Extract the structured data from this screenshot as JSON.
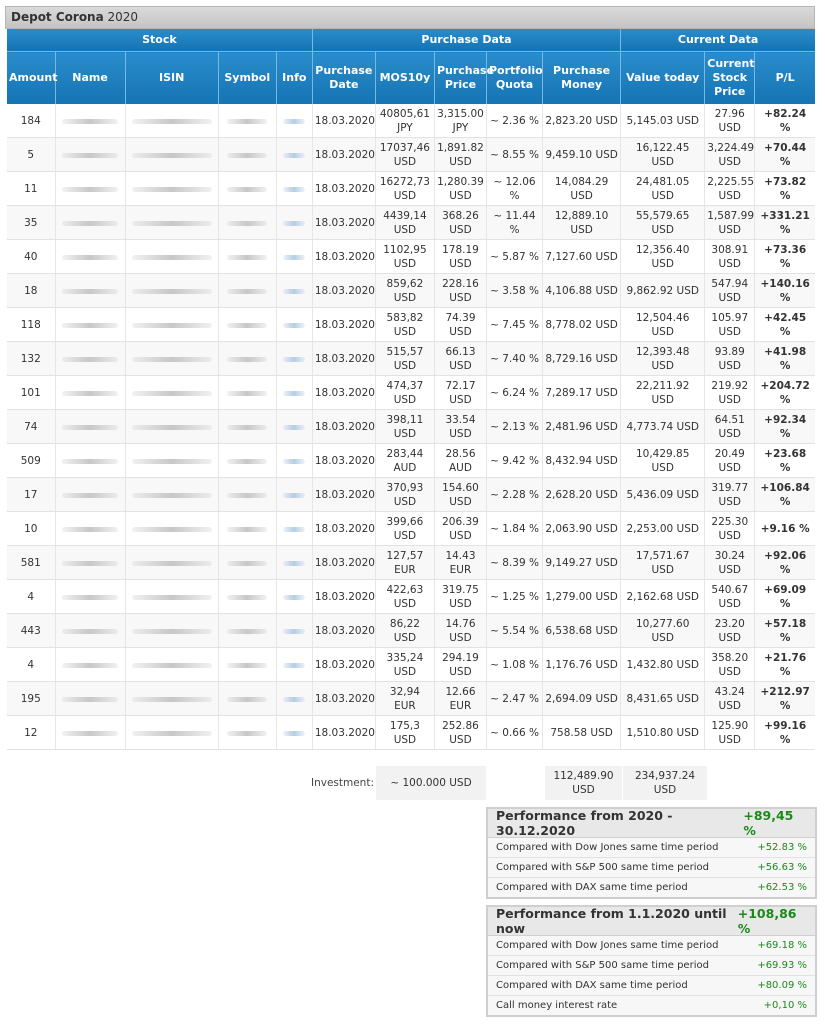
{
  "title": {
    "name": "Depot Corona",
    "year": "2020"
  },
  "groups": {
    "stock": "Stock",
    "purchase": "Purchase Data",
    "current": "Current Data"
  },
  "columns": {
    "amount": "Amount",
    "name": "Name",
    "isin": "ISIN",
    "symbol": "Symbol",
    "info": "Info",
    "purchase_date": "Purchase Date",
    "mos": "MOS10y",
    "purchase_price": "Purchase Price",
    "quota": "Portfolio Quota",
    "purchase_money": "Purchase Money",
    "value_today": "Value today",
    "current_price": "Current Stock Price",
    "pl": "P/L"
  },
  "rows": [
    {
      "amount": "184",
      "date": "18.03.2020",
      "mos": "40805,61",
      "mos_cur": "JPY",
      "price": "3,315.00",
      "price_cur": "JPY",
      "quota": "~ 2.36 %",
      "money": "2,823.20 USD",
      "value": "5,145.03 USD",
      "cur_price": "27.96",
      "cur_price_cur": "USD",
      "pl": "+82.24 %"
    },
    {
      "amount": "5",
      "date": "18.03.2020",
      "mos": "17037,46",
      "mos_cur": "USD",
      "price": "1,891.82",
      "price_cur": "USD",
      "quota": "~ 8.55 %",
      "money": "9,459.10 USD",
      "value": "16,122.45 USD",
      "cur_price": "3,224.49",
      "cur_price_cur": "USD",
      "pl": "+70.44 %"
    },
    {
      "amount": "11",
      "date": "18.03.2020",
      "mos": "16272,73",
      "mos_cur": "USD",
      "price": "1,280.39",
      "price_cur": "USD",
      "quota": "~ 12.06 %",
      "money": "14,084.29 USD",
      "value": "24,481.05 USD",
      "cur_price": "2,225.55",
      "cur_price_cur": "USD",
      "pl": "+73.82 %"
    },
    {
      "amount": "35",
      "date": "18.03.2020",
      "mos": "4439,14",
      "mos_cur": "USD",
      "price": "368.26",
      "price_cur": "USD",
      "quota": "~ 11.44 %",
      "money": "12,889.10 USD",
      "value": "55,579.65 USD",
      "cur_price": "1,587.99",
      "cur_price_cur": "USD",
      "pl": "+331.21 %"
    },
    {
      "amount": "40",
      "date": "18.03.2020",
      "mos": "1102,95",
      "mos_cur": "USD",
      "price": "178.19",
      "price_cur": "USD",
      "quota": "~ 5.87 %",
      "money": "7,127.60 USD",
      "value": "12,356.40 USD",
      "cur_price": "308.91",
      "cur_price_cur": "USD",
      "pl": "+73.36 %"
    },
    {
      "amount": "18",
      "date": "18.03.2020",
      "mos": "859,62",
      "mos_cur": "USD",
      "price": "228.16",
      "price_cur": "USD",
      "quota": "~ 3.58 %",
      "money": "4,106.88 USD",
      "value": "9,862.92 USD",
      "cur_price": "547.94",
      "cur_price_cur": "USD",
      "pl": "+140.16 %"
    },
    {
      "amount": "118",
      "date": "18.03.2020",
      "mos": "583,82",
      "mos_cur": "USD",
      "price": "74.39",
      "price_cur": "USD",
      "quota": "~ 7.45 %",
      "money": "8,778.02 USD",
      "value": "12,504.46 USD",
      "cur_price": "105.97",
      "cur_price_cur": "USD",
      "pl": "+42.45 %"
    },
    {
      "amount": "132",
      "date": "18.03.2020",
      "mos": "515,57",
      "mos_cur": "USD",
      "price": "66.13",
      "price_cur": "USD",
      "quota": "~ 7.40 %",
      "money": "8,729.16 USD",
      "value": "12,393.48 USD",
      "cur_price": "93.89",
      "cur_price_cur": "USD",
      "pl": "+41.98 %"
    },
    {
      "amount": "101",
      "date": "18.03.2020",
      "mos": "474,37",
      "mos_cur": "USD",
      "price": "72.17",
      "price_cur": "USD",
      "quota": "~ 6.24 %",
      "money": "7,289.17 USD",
      "value": "22,211.92 USD",
      "cur_price": "219.92",
      "cur_price_cur": "USD",
      "pl": "+204.72 %"
    },
    {
      "amount": "74",
      "date": "18.03.2020",
      "mos": "398,11",
      "mos_cur": "USD",
      "price": "33.54",
      "price_cur": "USD",
      "quota": "~ 2.13 %",
      "money": "2,481.96 USD",
      "value": "4,773.74 USD",
      "cur_price": "64.51",
      "cur_price_cur": "USD",
      "pl": "+92.34 %"
    },
    {
      "amount": "509",
      "date": "18.03.2020",
      "mos": "283,44",
      "mos_cur": "AUD",
      "price": "28.56",
      "price_cur": "AUD",
      "quota": "~ 9.42 %",
      "money": "8,432.94 USD",
      "value": "10,429.85 USD",
      "cur_price": "20.49",
      "cur_price_cur": "USD",
      "pl": "+23.68 %"
    },
    {
      "amount": "17",
      "date": "18.03.2020",
      "mos": "370,93",
      "mos_cur": "USD",
      "price": "154.60",
      "price_cur": "USD",
      "quota": "~ 2.28 %",
      "money": "2,628.20 USD",
      "value": "5,436.09 USD",
      "cur_price": "319.77",
      "cur_price_cur": "USD",
      "pl": "+106.84 %"
    },
    {
      "amount": "10",
      "date": "18.03.2020",
      "mos": "399,66",
      "mos_cur": "USD",
      "price": "206.39",
      "price_cur": "USD",
      "quota": "~ 1.84 %",
      "money": "2,063.90 USD",
      "value": "2,253.00 USD",
      "cur_price": "225.30",
      "cur_price_cur": "USD",
      "pl": "+9.16 %"
    },
    {
      "amount": "581",
      "date": "18.03.2020",
      "mos": "127,57",
      "mos_cur": "EUR",
      "price": "14.43 EUR",
      "price_cur": "",
      "quota": "~ 8.39 %",
      "money": "9,149.27 USD",
      "value": "17,571.67 USD",
      "cur_price": "30.24",
      "cur_price_cur": "USD",
      "pl": "+92.06 %"
    },
    {
      "amount": "4",
      "date": "18.03.2020",
      "mos": "422,63",
      "mos_cur": "USD",
      "price": "319.75",
      "price_cur": "USD",
      "quota": "~ 1.25 %",
      "money": "1,279.00 USD",
      "value": "2,162.68 USD",
      "cur_price": "540.67",
      "cur_price_cur": "USD",
      "pl": "+69.09 %"
    },
    {
      "amount": "443",
      "date": "18.03.2020",
      "mos": "86,22",
      "mos_cur": "USD",
      "price": "14.76",
      "price_cur": "USD",
      "quota": "~ 5.54 %",
      "money": "6,538.68 USD",
      "value": "10,277.60 USD",
      "cur_price": "23.20",
      "cur_price_cur": "USD",
      "pl": "+57.18 %"
    },
    {
      "amount": "4",
      "date": "18.03.2020",
      "mos": "335,24",
      "mos_cur": "USD",
      "price": "294.19",
      "price_cur": "USD",
      "quota": "~ 1.08 %",
      "money": "1,176.76 USD",
      "value": "1,432.80 USD",
      "cur_price": "358.20",
      "cur_price_cur": "USD",
      "pl": "+21.76 %"
    },
    {
      "amount": "195",
      "date": "18.03.2020",
      "mos": "32,94",
      "mos_cur": "EUR",
      "price": "12.66 EUR",
      "price_cur": "",
      "quota": "~ 2.47 %",
      "money": "2,694.09 USD",
      "value": "8,431.65 USD",
      "cur_price": "43.24",
      "cur_price_cur": "USD",
      "pl": "+212.97 %"
    },
    {
      "amount": "12",
      "date": "18.03.2020",
      "mos": "175,3",
      "mos_cur": "USD",
      "price": "252.86",
      "price_cur": "USD",
      "quota": "~ 0.66 %",
      "money": "758.58 USD",
      "value": "1,510.80 USD",
      "cur_price": "125.90",
      "cur_price_cur": "USD",
      "pl": "+99.16 %"
    }
  ],
  "summary": {
    "investment_label": "Investment:",
    "investment_value": "~ 100.000 USD",
    "money_total": "112,489.90",
    "money_total_cur": "USD",
    "value_total": "234,937.24 USD"
  },
  "perf1": {
    "title": "Performance from 2020 - 30.12.2020",
    "value": "+89,45 %",
    "rows": [
      {
        "label": "Compared with Dow Jones same time period",
        "value": "+52.83 %"
      },
      {
        "label": "Compared with S&P 500 same time period",
        "value": "+56.63 %"
      },
      {
        "label": "Compared with DAX same time period",
        "value": "+62.53 %"
      }
    ]
  },
  "perf2": {
    "title": "Performance from 1.1.2020 until now",
    "value": "+108,86 %",
    "rows": [
      {
        "label": "Compared with Dow Jones same time period",
        "value": "+69.18 %"
      },
      {
        "label": "Compared with S&P 500 same time period",
        "value": "+69.93 %"
      },
      {
        "label": "Compared with DAX same time period",
        "value": "+80.09 %"
      },
      {
        "label": "Call money interest rate",
        "value": "+0,10 %"
      }
    ]
  },
  "colors": {
    "header_blue": "#1e80c1",
    "positive_green": "#1a8a1a"
  }
}
